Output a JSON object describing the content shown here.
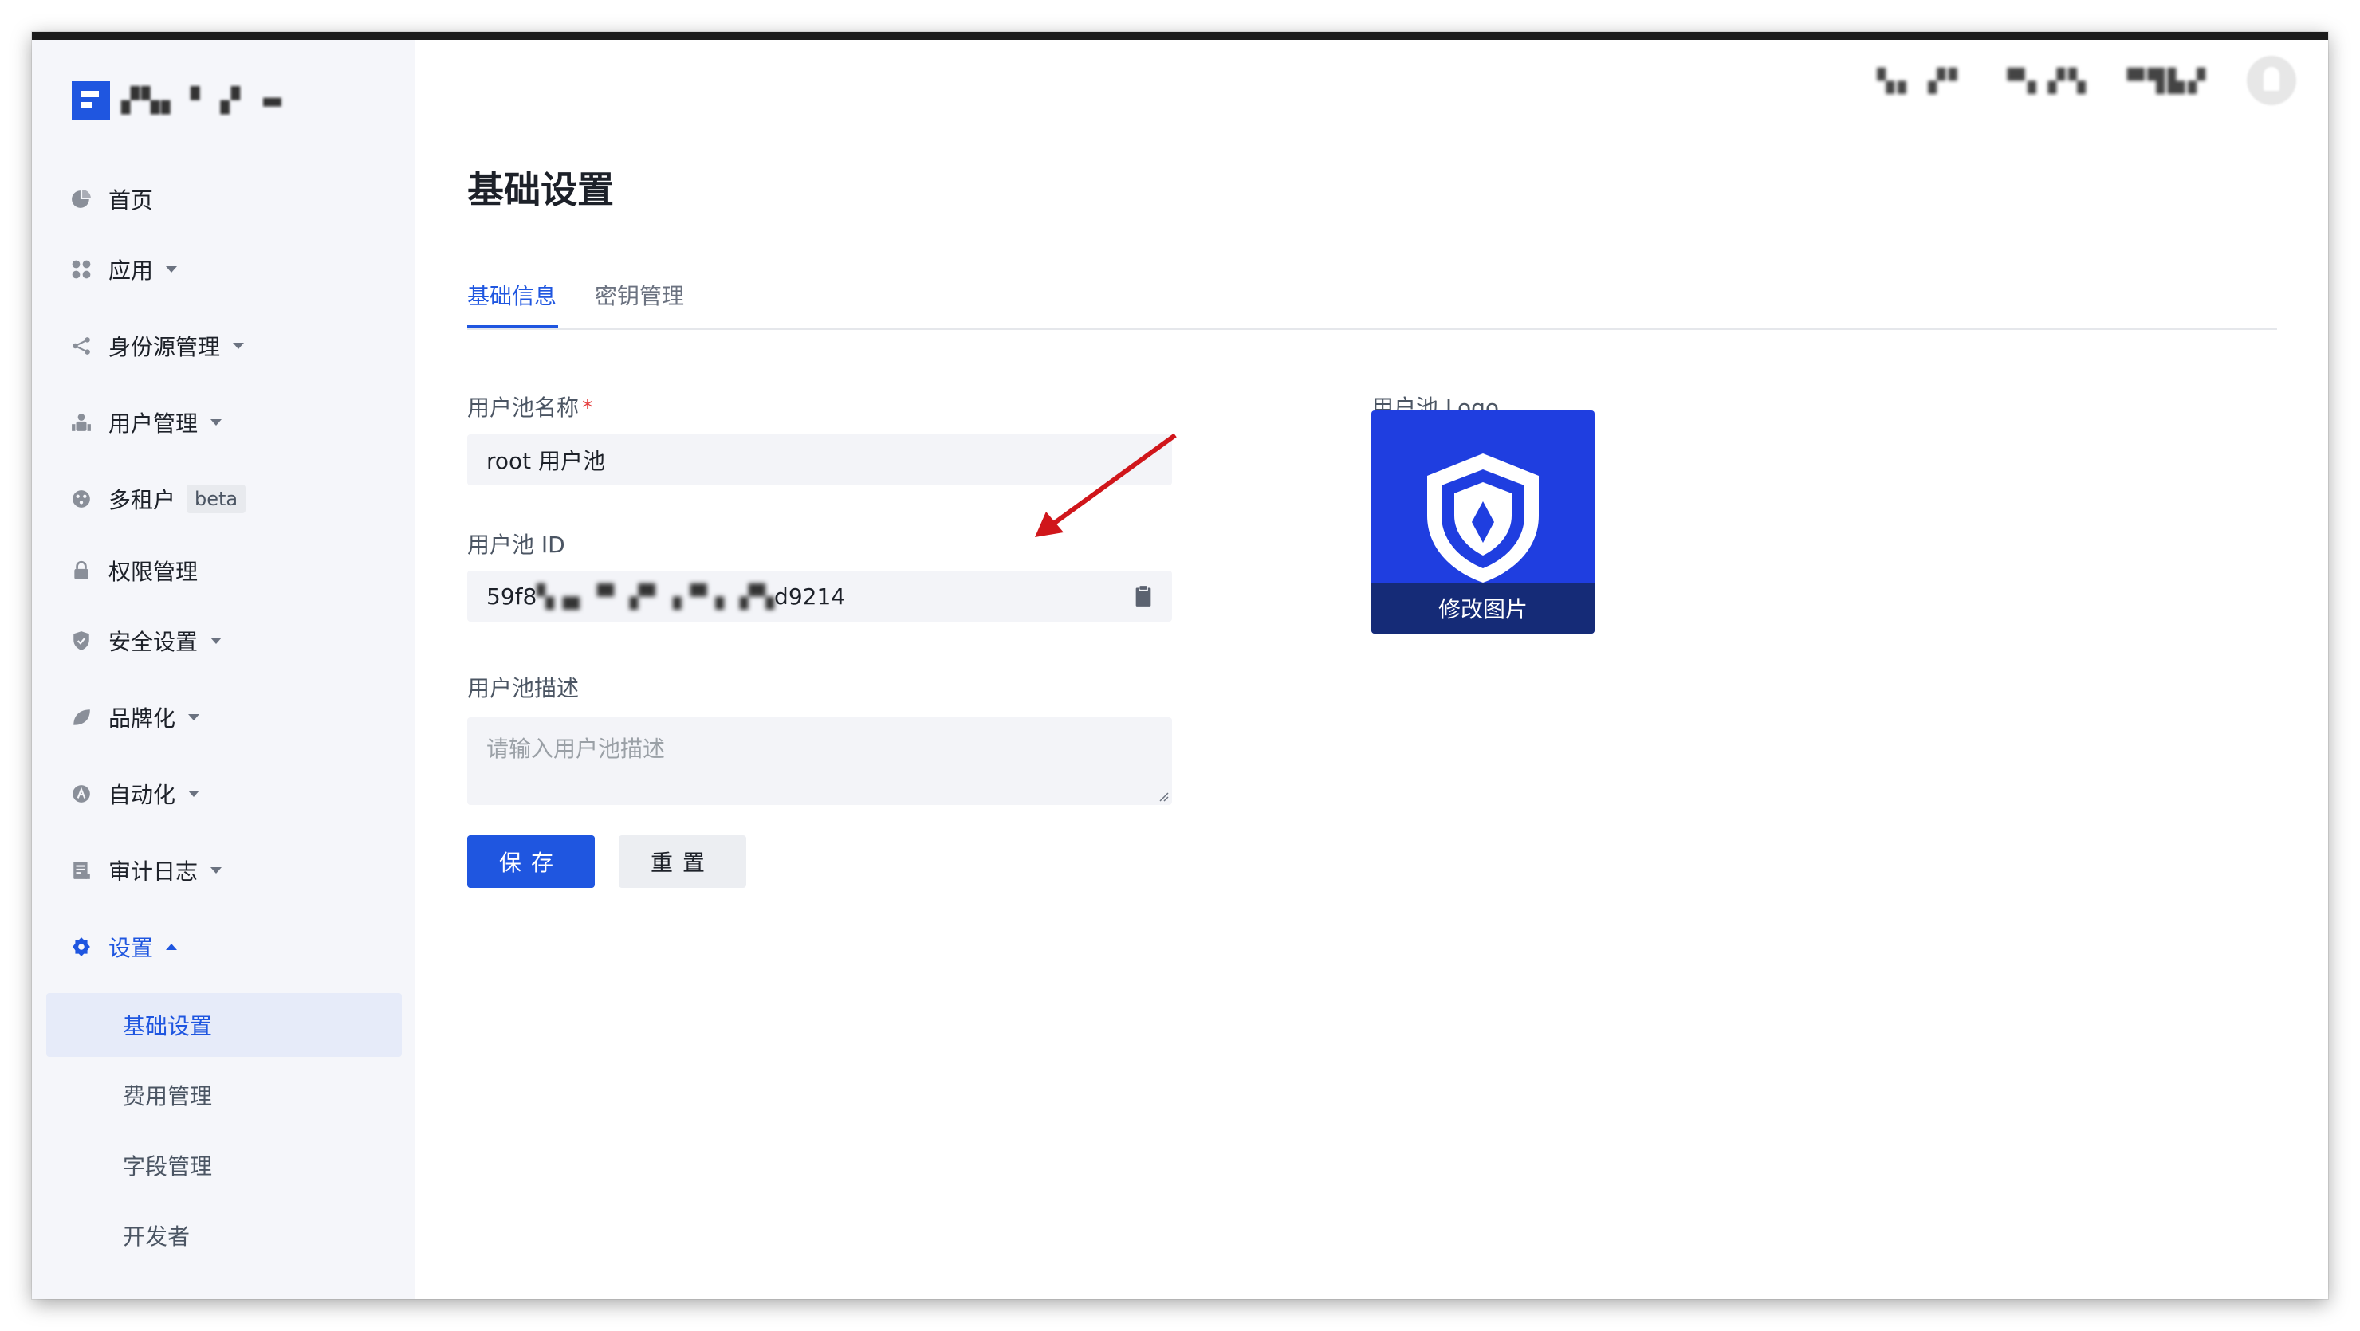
{
  "brand": {
    "name": "▞▚▖▝ ▗▘ ▬"
  },
  "header": {
    "item1": "▚▖ ▞▘",
    "item2": "▀▖▞▚",
    "item3": "▀▜▙▞"
  },
  "sidebar": {
    "items": [
      {
        "label": "首页",
        "icon": "pie-chart-icon"
      },
      {
        "label": "应用",
        "icon": "apps-icon"
      },
      {
        "label": "身份源管理",
        "icon": "share-icon"
      },
      {
        "label": "用户管理",
        "icon": "users-icon"
      },
      {
        "label": "多租户",
        "icon": "tenant-icon",
        "badge": "beta"
      },
      {
        "label": "权限管理",
        "icon": "lock-icon"
      },
      {
        "label": "安全设置",
        "icon": "shield-icon"
      },
      {
        "label": "品牌化",
        "icon": "leaf-icon"
      },
      {
        "label": "自动化",
        "icon": "automation-icon"
      },
      {
        "label": "审计日志",
        "icon": "log-icon"
      },
      {
        "label": "设置",
        "icon": "gear-icon"
      }
    ],
    "settings_sub": [
      {
        "label": "基础设置"
      },
      {
        "label": "费用管理"
      },
      {
        "label": "字段管理"
      },
      {
        "label": "开发者"
      }
    ]
  },
  "main": {
    "title": "基础设置",
    "tabs": [
      {
        "label": "基础信息"
      },
      {
        "label": "密钥管理"
      }
    ],
    "form": {
      "name_label": "用户池名称",
      "name_required": "*",
      "name_value": "root 用户池",
      "id_label": "用户池 ID",
      "id_prefix": "59f8",
      "id_masked": "▚▗▖▝▘ ▞▘▗▝▘▖ ▞▚",
      "id_suffix": "d9214",
      "desc_label": "用户池描述",
      "desc_placeholder": "请输入用户池描述",
      "save_label": "保存",
      "reset_label": "重置"
    },
    "logo": {
      "label": "用户池 Logo",
      "change_label": "修改图片"
    }
  },
  "colors": {
    "accent": "#1f56e0",
    "logo_bg": "#1f3ee0",
    "arrow": "#d0161b"
  }
}
